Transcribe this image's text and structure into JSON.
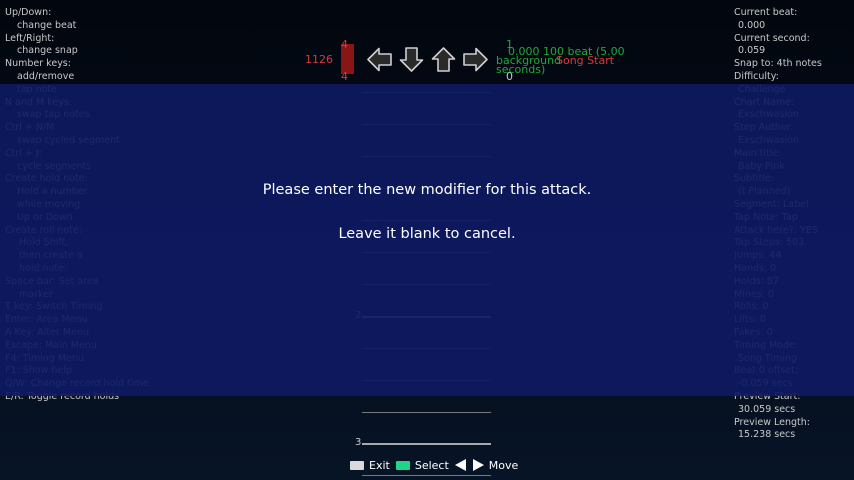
{
  "help": [
    {
      "text": "Up/Down:",
      "indent": 0
    },
    {
      "text": "change beat",
      "indent": 1
    },
    {
      "text": "Left/Right:",
      "indent": 0
    },
    {
      "text": "change snap",
      "indent": 1
    },
    {
      "text": "Number keys:",
      "indent": 0
    },
    {
      "text": "add/remove",
      "indent": 1
    },
    {
      "text": "tap note",
      "indent": 1
    },
    {
      "text": "N and M keys:",
      "indent": 0
    },
    {
      "text": "swap tap notes",
      "indent": 1
    },
    {
      "text": "Ctrl + N/M",
      "indent": 0
    },
    {
      "text": "swap cycled segment",
      "indent": 1
    },
    {
      "text": "Ctrl + J:",
      "indent": 0
    },
    {
      "text": "cycle segments",
      "indent": 1
    },
    {
      "text": "Create hold note:",
      "indent": 0
    },
    {
      "text": "Hold a number",
      "indent": 1
    },
    {
      "text": "while moving",
      "indent": 1
    },
    {
      "text": "Up or Down",
      "indent": 1
    },
    {
      "text": "Create roll note:",
      "indent": 0
    },
    {
      "text": "Hold Shift,",
      "indent": 2
    },
    {
      "text": "then create a",
      "indent": 2
    },
    {
      "text": "hold note.",
      "indent": 2
    },
    {
      "text": "Space bar: Set area",
      "indent": 0
    },
    {
      "text": "marker",
      "indent": 2
    },
    {
      "text": "T key: Switch Timing",
      "indent": 0
    },
    {
      "text": "Enter: Area Menu",
      "indent": 0
    },
    {
      "text": "A Key: Alter Menu",
      "indent": 0
    },
    {
      "text": "Escape: Main Menu",
      "indent": 0
    },
    {
      "text": "F4: Timing Menu",
      "indent": 0
    },
    {
      "text": "F1: Show help",
      "indent": 0
    },
    {
      "text": "Q/W: Change record hold time",
      "indent": 0
    },
    {
      "text": "E/R: Toggle record holds",
      "indent": 0
    }
  ],
  "info": [
    {
      "label": "Current beat:",
      "value": "0.000"
    },
    {
      "label": "Current second:",
      "value": "0.059"
    },
    {
      "label": "Snap to: 4th notes",
      "value": null
    },
    {
      "label": "Difficulty:",
      "value": "Challenge"
    },
    {
      "label": "Chart Name:",
      "value": "Exschwasion"
    },
    {
      "label": "Step Author:",
      "value": "Exschwasion"
    },
    {
      "label": "Main title:",
      "value": "Baby Pink"
    },
    {
      "label": "Subtitle:",
      "value": "(t Planned)"
    },
    {
      "label": "Segment: Label",
      "value": null
    },
    {
      "label": "Tap Note: Tap",
      "value": null
    },
    {
      "label": "Attack here?: YES",
      "value": null
    },
    {
      "label": "Tap Steps: 503",
      "value": null
    },
    {
      "label": "Jumps: 44",
      "value": null
    },
    {
      "label": "Hands: 0",
      "value": null
    },
    {
      "label": "Holds: 87",
      "value": null
    },
    {
      "label": "Mines: 0",
      "value": null
    },
    {
      "label": "Rolls: 0",
      "value": null
    },
    {
      "label": "Lifts: 0",
      "value": null
    },
    {
      "label": "Fakes: 0",
      "value": null
    },
    {
      "label": "Timing Mode:",
      "value": "Song Timing"
    },
    {
      "label": "Beat 0 offset:",
      "value": "-0.059 secs"
    },
    {
      "label": "Preview Start:",
      "value": "30.059 secs"
    },
    {
      "label": "Preview Length:",
      "value": "15.238 secs"
    }
  ],
  "field": {
    "bpm_left": "126",
    "bpm_one": "1",
    "stop_top": "4",
    "stop_bottom": "4",
    "right_one": "1",
    "right_zero": "0",
    "bpm_change_text": "0.000 100 beat (5.00",
    "seconds_text": "seconds)",
    "bg_label": "background",
    "song_start": "Song Start",
    "beat_2": "2",
    "beat_3": "3"
  },
  "modal": {
    "line1": "Please enter the new modifier for this attack.",
    "line2": "Leave it blank to cancel."
  },
  "footer": {
    "exit": "Exit",
    "select": "Select",
    "move": "Move"
  },
  "colors": {
    "overlay": "#0e1a62",
    "bpm_red": "#d83a3a",
    "select_key": "#22d38a",
    "green_tag": "#1fa83a"
  }
}
